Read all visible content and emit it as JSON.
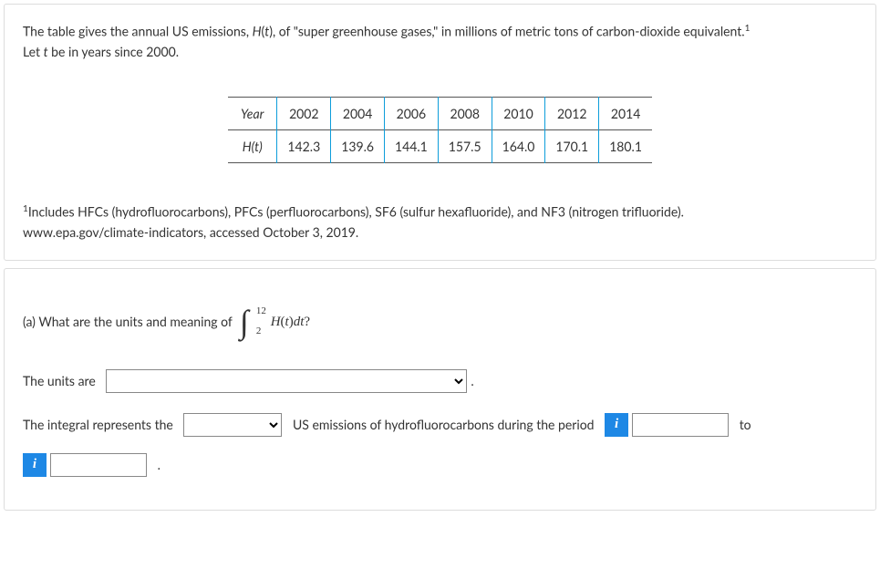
{
  "intro": {
    "line1_a": "The table gives the annual US emissions, ",
    "line1_func": "H",
    "line1_paren_open": "(",
    "line1_var": "t",
    "line1_paren_close": ")",
    "line1_b": ", of \"super greenhouse gases,\" in millions of metric tons of carbon-dioxide equivalent.",
    "line1_sup": "1",
    "line2_a": "Let ",
    "line2_var": "t",
    "line2_b": " be in years since 2000."
  },
  "table": {
    "row1_label": "Year",
    "row1": [
      "2002",
      "2004",
      "2006",
      "2008",
      "2010",
      "2012",
      "2014"
    ],
    "row2_label": "H(t)",
    "row2": [
      "142.3",
      "139.6",
      "144.1",
      "157.5",
      "164.0",
      "170.1",
      "180.1"
    ]
  },
  "footnote": {
    "sup": "1",
    "text1": "Includes HFCs (hydrofluorocarbons), PFCs (perfluorocarbons), SF6 (sulfur hexafluoride), and NF3 (nitrogen trifluoride).",
    "text2": "www.epa.gov/climate-indicators, accessed October 3, 2019."
  },
  "qa": {
    "label": "(a) What are the units and meaning of",
    "int_upper": "12",
    "int_lower": "2",
    "integrand_H": "H",
    "integrand_t": "t",
    "integrand_d": "d",
    "integrand_t2": "t",
    "question_mark": "?"
  },
  "units_row": {
    "label": "The units are",
    "period": "."
  },
  "meaning_row": {
    "label_a": "The integral represents the",
    "text_mid": "US emissions of hydrofluorocarbons during the period",
    "to": "to",
    "period": ".",
    "info": "i"
  },
  "chart_data": {
    "type": "table",
    "title": "Annual US emissions H(t) of super greenhouse gases, millions of metric tons CO2 equivalent",
    "xlabel": "Year",
    "ylabel": "H(t)",
    "categories": [
      2002,
      2004,
      2006,
      2008,
      2010,
      2012,
      2014
    ],
    "values": [
      142.3,
      139.6,
      144.1,
      157.5,
      164.0,
      170.1,
      180.1
    ]
  }
}
